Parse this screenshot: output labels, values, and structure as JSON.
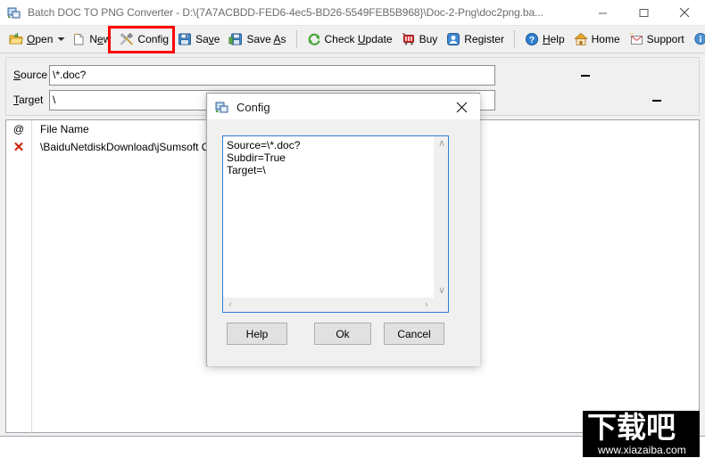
{
  "window": {
    "title": "Batch DOC TO PNG Converter - D:\\{7A7ACBDD-FED6-4ec5-BD26-5549FEB5B968}\\Doc-2-Png\\doc2png.ba...",
    "icon": "app-icon",
    "minimize_label": "—",
    "maximize_label": "☐",
    "close_label": "✕"
  },
  "toolbar": {
    "items": [
      {
        "id": "open",
        "label": "Open",
        "accel": "O",
        "icon": "open-folder-icon",
        "has_dropdown": true
      },
      {
        "id": "new",
        "label": "New",
        "accel": "e",
        "icon": "new-file-icon",
        "has_dropdown": false
      },
      {
        "id": "config",
        "label": "Config",
        "accel": "",
        "icon": "tools-icon",
        "has_dropdown": false
      },
      {
        "id": "save",
        "label": "Save",
        "accel": "v",
        "icon": "floppy-icon",
        "has_dropdown": false
      },
      {
        "id": "save-as",
        "label": "Save As",
        "accel": "A",
        "icon": "floppy-as-icon",
        "has_dropdown": false
      },
      {
        "id": "check-update",
        "label": "Check Update",
        "accel": "U",
        "icon": "refresh-icon",
        "has_dropdown": false
      },
      {
        "id": "buy",
        "label": "Buy",
        "accel": "",
        "icon": "cart-icon",
        "has_dropdown": false
      },
      {
        "id": "register",
        "label": "Register",
        "accel": "",
        "icon": "key-icon",
        "has_dropdown": false
      },
      {
        "id": "help",
        "label": "Help",
        "accel": "H",
        "icon": "question-icon",
        "has_dropdown": false
      },
      {
        "id": "home",
        "label": "Home",
        "accel": "",
        "icon": "house-icon",
        "has_dropdown": false
      },
      {
        "id": "support",
        "label": "Support",
        "accel": "",
        "icon": "mail-icon",
        "has_dropdown": false
      },
      {
        "id": "about",
        "label": "About",
        "accel": "",
        "icon": "info-icon",
        "has_dropdown": false
      }
    ],
    "highlight": {
      "target": "config",
      "color": "#ff0000"
    }
  },
  "fields": {
    "source": {
      "label": "Source",
      "accel": "S",
      "value": "\\*.doc?"
    },
    "target": {
      "label": "Target",
      "accel": "T",
      "value": "\\"
    }
  },
  "list": {
    "columns": [
      {
        "id": "status",
        "label": "@"
      },
      {
        "id": "name",
        "label": "File Name"
      }
    ],
    "rows": [
      {
        "status": "✕",
        "status_color": "#cc2200",
        "name": "\\BaiduNetdiskDownload\\jSumsoft Office F"
      }
    ]
  },
  "dialog": {
    "title": "Config",
    "icon": "app-icon",
    "close_label": "✕",
    "memo_text": "Source=\\*.doc?\nSubdir=True\nTarget=\\",
    "scrollbar": {
      "up": "∧",
      "down": "∨",
      "left": "‹",
      "right": "›"
    },
    "buttons": [
      {
        "id": "help",
        "label": "Help"
      },
      {
        "id": "ok",
        "label": "Ok"
      },
      {
        "id": "cancel",
        "label": "Cancel"
      }
    ]
  },
  "watermark": {
    "text": "下载吧",
    "url": "www.xiazaiba.com"
  }
}
